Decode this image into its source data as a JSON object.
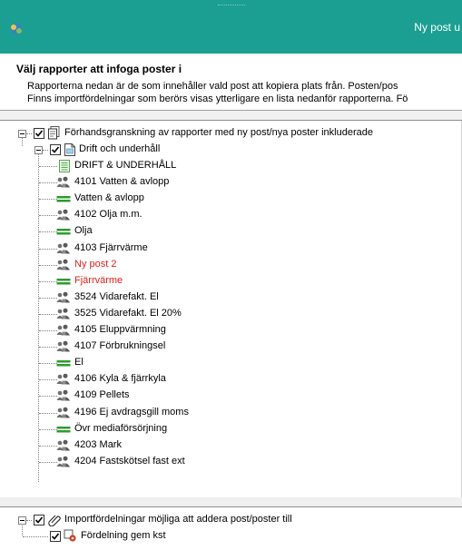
{
  "window": {
    "title": "Ny post u"
  },
  "header": {
    "heading": "Välj rapporter att infoga poster i",
    "desc_line1": "Rapporterna nedan är de som innehåller vald post att kopiera plats från. Posten/pos",
    "desc_line2": "Finns importfördelningar som berörs visas ytterligare en lista nedanför rapporterna. Fö"
  },
  "tree": {
    "root_label": "Förhandsgranskning av rapporter med ny post/nya poster inkluderade",
    "report_label": "Drift och underhåll",
    "items": [
      {
        "label": "DRIFT & UNDERHÅLL",
        "icon": "report-sheet-icon",
        "red": false
      },
      {
        "label": "4101 Vatten & avlopp",
        "icon": "account-people-icon",
        "red": false
      },
      {
        "label": "Vatten & avlopp",
        "icon": "sum-line-icon",
        "red": false
      },
      {
        "label": "4102 Olja m.m.",
        "icon": "account-people-icon",
        "red": false
      },
      {
        "label": "Olja",
        "icon": "sum-line-icon",
        "red": false
      },
      {
        "label": "4103 Fjärrvärme",
        "icon": "account-people-icon",
        "red": false
      },
      {
        "label": "Ny post 2",
        "icon": "account-people-icon",
        "red": true
      },
      {
        "label": "Fjärrvärme",
        "icon": "sum-line-icon",
        "red": true
      },
      {
        "label": "3524 Vidarefakt. El",
        "icon": "account-people-icon",
        "red": false
      },
      {
        "label": "3525 Vidarefakt. El 20%",
        "icon": "account-people-icon",
        "red": false
      },
      {
        "label": "4105 Eluppvärmning",
        "icon": "account-people-icon",
        "red": false
      },
      {
        "label": "4107 Förbrukningsel",
        "icon": "account-people-icon",
        "red": false
      },
      {
        "label": "El",
        "icon": "sum-line-icon",
        "red": false
      },
      {
        "label": "4106 Kyla & fjärrkyla",
        "icon": "account-people-icon",
        "red": false
      },
      {
        "label": "4109 Pellets",
        "icon": "account-people-icon",
        "red": false
      },
      {
        "label": "4196 Ej avdragsgill moms",
        "icon": "account-people-icon",
        "red": false
      },
      {
        "label": "Övr mediaförsörjning",
        "icon": "sum-line-icon",
        "red": false
      },
      {
        "label": "4203 Mark",
        "icon": "account-people-icon",
        "red": false
      },
      {
        "label": "4204 Fastskötsel fast ext",
        "icon": "account-people-icon",
        "red": false
      }
    ]
  },
  "import_tree": {
    "root_label": "Importfördelningar möjliga att addera post/poster till",
    "child_label": "Fördelning gem kst"
  }
}
